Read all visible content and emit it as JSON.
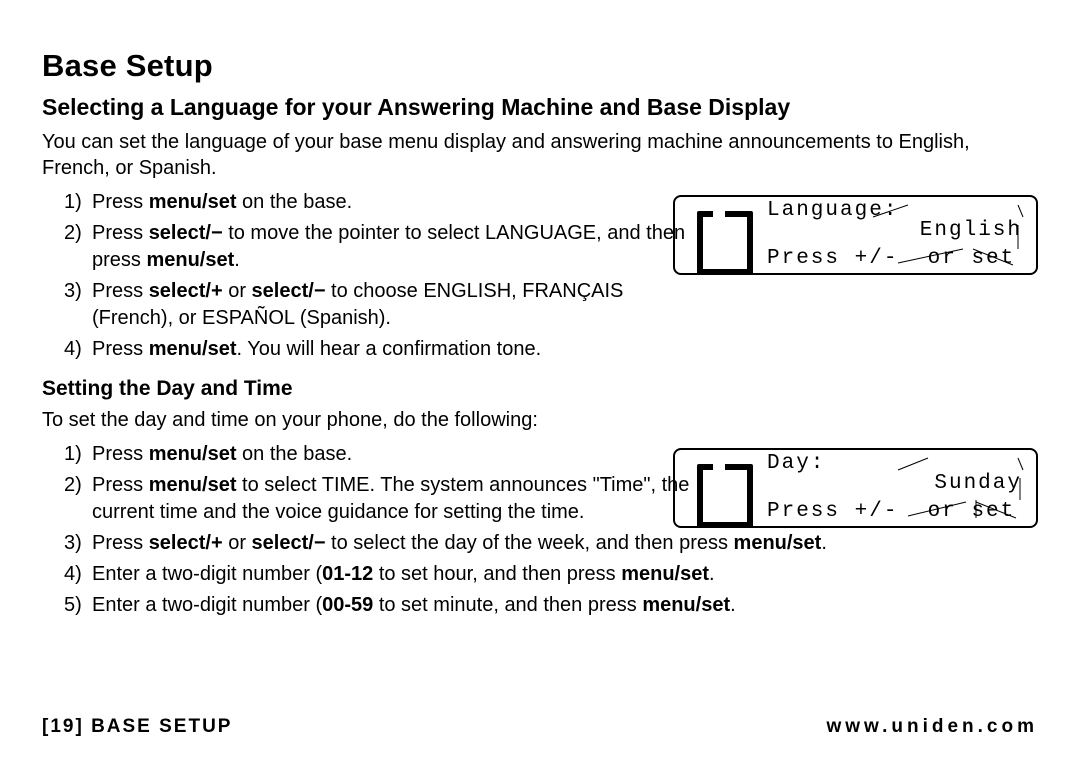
{
  "title": "Base Setup",
  "section1": {
    "heading": "Selecting a Language for your Answering Machine and Base Display",
    "intro": "You can set the language of your base menu display and answering machine announcements to English, French, or Spanish.",
    "steps": [
      {
        "pre": "Press ",
        "b": "menu/set",
        "post": " on the base."
      },
      {
        "pre": "Press ",
        "b": "select/−",
        "post": " to move the pointer to select LANGUAGE, and then press ",
        "b2": "menu/set",
        "post2": "."
      },
      {
        "pre": "Press ",
        "b": "select/+",
        "mid": " or ",
        "b2": "select/−",
        "post": " to choose ENGLISH, FRANÇAIS (French), or ESPAÑOL (Spanish)."
      },
      {
        "pre": "Press ",
        "b": "menu/set",
        "post": ". You will hear a confirmation tone."
      }
    ],
    "lcd": {
      "line1": "Language:",
      "value": "English",
      "hint_left": "Press +/-",
      "hint_right": "or set"
    }
  },
  "section2": {
    "heading": "Setting the Day and Time",
    "intro": "To set the day and time on your phone, do the following:",
    "steps": [
      {
        "pre": "Press ",
        "b": "menu/set",
        "post": " on the base."
      },
      {
        "pre": "Press ",
        "b": "menu/set",
        "post": " to select TIME. The system announces \"Time\", the current time and the voice guidance for setting the time."
      },
      {
        "pre": "Press ",
        "b": "select/+",
        "mid": " or ",
        "b2": "select/−",
        "post": " to select the day of the week, and then press ",
        "b3": "menu/set",
        "post2": "."
      },
      {
        "pre": "Enter a two-digit number (",
        "b": "01-12",
        "post": " to set hour, and then press ",
        "b2": "menu/set",
        "post2": "."
      },
      {
        "pre": "Enter a two-digit number (",
        "b": "00-59",
        "post": " to set minute, and then press ",
        "b2": "menu/set",
        "post2": "."
      }
    ],
    "lcd": {
      "line1": "Day:",
      "value": "Sunday",
      "hint_left": "Press +/-",
      "hint_right": "or set"
    }
  },
  "footer": {
    "page_label": "[19] BASE SETUP",
    "url": "www.uniden.com"
  }
}
